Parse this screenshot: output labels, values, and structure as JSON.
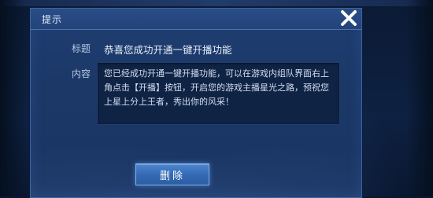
{
  "dialog": {
    "title": "提示",
    "close_icon": "close-icon",
    "subject_label": "标题",
    "subject_value": "恭喜您成功开通一键开播功能",
    "content_label": "内容",
    "content_text": "您已经成功开通一键开播功能，可以在游戏内组队界面右上角点击【开播】按钮，开启您的游戏主播星光之路，预祝您上星上分上王者，秀出你的风采！",
    "delete_label": "删除"
  },
  "colors": {
    "dialog_bg": "#1b3867",
    "title_bar": "#23437a",
    "content_box": "#0f2345",
    "button": "#356bb4",
    "text": "#e8eef9"
  }
}
